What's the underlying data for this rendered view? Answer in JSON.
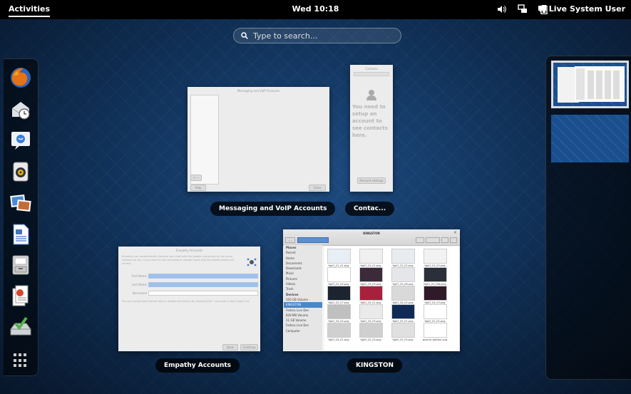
{
  "topbar": {
    "activities_label": "Activities",
    "clock": "Wed 10:18",
    "user_label": "Live System User",
    "tray_icons": [
      "volume-icon",
      "network-icon",
      "battery-icon"
    ]
  },
  "search": {
    "placeholder": "Type to search..."
  },
  "dash": {
    "apps": [
      "firefox-icon",
      "evolution-icon",
      "empathy-icon",
      "rhythmbox-icon",
      "shotwell-icon",
      "writer-icon",
      "files-icon",
      "document-viewer-icon",
      "install-icon"
    ],
    "show_apps_label": "show-applications-icon"
  },
  "windows": {
    "messaging": {
      "caption": "Messaging and VoIP Accounts",
      "title": "Messaging and VoIP Accounts",
      "help": "Help",
      "close": "Close"
    },
    "contacts": {
      "caption": "Contac...",
      "title": "Contacts",
      "message": "You need to setup an account to see contacts here.",
      "button": "Account settings"
    },
    "empathy": {
      "caption": "Empathy Accounts",
      "title": "Empathy Accounts",
      "intro": "Empathy can automatically discover and chat with the people connected on the same network as you. If you want to use this feature, please check that the details below are correct.",
      "fields": [
        "First Name",
        "Last Name",
        "Nickname"
      ],
      "note": "You can change these details later or disable this feature by choosing Edit → Accounts in the Contact List.",
      "back": "Back",
      "apply": "Continue"
    },
    "kingston": {
      "caption": "KINGSTON",
      "title": "KINGSTON",
      "sidebar": [
        {
          "label": "Places",
          "kind": "hd"
        },
        {
          "label": "Recent"
        },
        {
          "label": "Home"
        },
        {
          "label": "Documents"
        },
        {
          "label": "Downloads"
        },
        {
          "label": "Music"
        },
        {
          "label": "Pictures"
        },
        {
          "label": "Videos"
        },
        {
          "label": "Trash"
        },
        {
          "label": "Devices",
          "kind": "hd"
        },
        {
          "label": "500 GB Volume"
        },
        {
          "label": "KINGSTON",
          "kind": "sel"
        },
        {
          "label": "Fedora Live Des"
        },
        {
          "label": "828 MB Volume"
        },
        {
          "label": "11 GB Volume"
        },
        {
          "label": "Fedora Live Des"
        },
        {
          "label": "Computer"
        }
      ],
      "files": [
        "fig01_01_01.png",
        "fig01_01_01.png",
        "fig01_01_02.png",
        "fig01_01_03.png",
        "fig01_01_04.png",
        "fig01_03_05.png",
        "fig01_03_06.png",
        "fig01_03_08a.png",
        "fig01_02_07.png",
        "fig01_04_01.png",
        "fig01_04_02.png",
        "fig01_04_03.png",
        "fig01_04_04.png",
        "fig01_04_05.png",
        "fig01_05_01.png",
        "fig02_01_02.png",
        "fig01_04_01.png",
        "fig05_02_04.png",
        "fig05_02_05.png",
        "gnome_bottom.png"
      ]
    }
  }
}
